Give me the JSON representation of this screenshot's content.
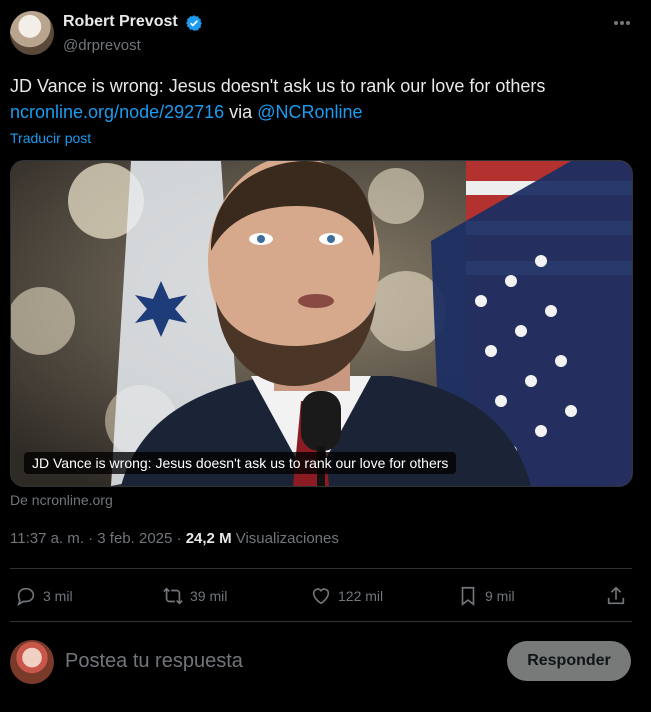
{
  "author": {
    "name": "Robert Prevost",
    "handle": "@drprevost",
    "verified_color": "#1d9bf0"
  },
  "tweet": {
    "text_line1": "JD Vance is wrong: Jesus doesn't ask us to rank our love for others",
    "link": "ncronline.org/node/292716",
    "via_word": " via ",
    "via_handle": "@NCRonline",
    "translate_label": "Traducir post"
  },
  "card": {
    "caption": "JD Vance is wrong: Jesus doesn't ask us to rank our love for others",
    "source": "De ncronline.org"
  },
  "meta": {
    "time": "11:37 a. m.",
    "separator1": " · ",
    "date": "3 feb. 2025",
    "separator2": " · ",
    "views_count": "24,2 M",
    "views_label": " Visualizaciones"
  },
  "actions": {
    "replies": "3 mil",
    "reposts": "39 mil",
    "likes": "122 mil",
    "bookmarks": "9 mil"
  },
  "reply_box": {
    "placeholder": "Postea tu respuesta",
    "button": "Responder"
  }
}
